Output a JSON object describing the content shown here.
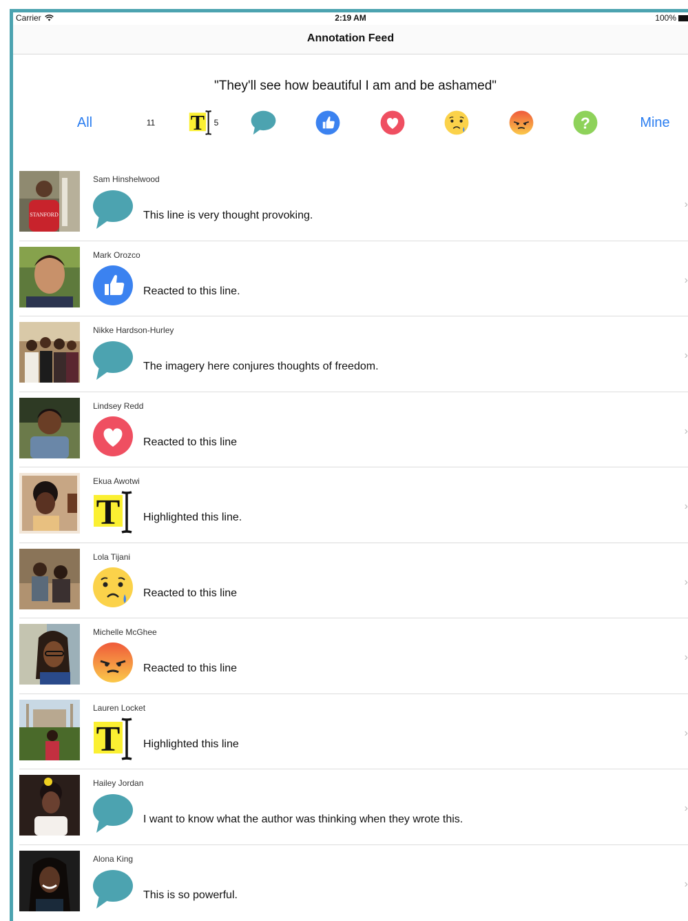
{
  "status_bar": {
    "carrier": "Carrier",
    "time": "2:19 AM",
    "battery": "100%"
  },
  "nav": {
    "title": "Annotation Feed"
  },
  "quote": "\"They'll see how beautiful I am and be ashamed\"",
  "filters": {
    "all_label": "All",
    "all_count": "11",
    "highlight_count": "5",
    "mine_label": "Mine",
    "icons": [
      "comment-icon",
      "like-icon",
      "heart-icon",
      "sad-icon",
      "angry-icon",
      "question-icon"
    ]
  },
  "colors": {
    "accent_blue": "#2a7df0",
    "comment_teal": "#4ca3b0",
    "like_blue": "#3b82f0",
    "heart_red": "#ef4f61",
    "emoji_yellow": "#fbd24a",
    "angry_orange": "#f1703a",
    "question_green": "#8ed25a",
    "highlight_yellow": "#fbf032"
  },
  "feed": [
    {
      "name": "Sam Hinshelwood",
      "type": "comment",
      "text": "This line is very thought provoking."
    },
    {
      "name": "Mark Orozco",
      "type": "like",
      "text": "Reacted to this line."
    },
    {
      "name": "Nikke Hardson-Hurley",
      "type": "comment",
      "text": "The imagery here conjures thoughts of freedom."
    },
    {
      "name": "Lindsey Redd",
      "type": "heart",
      "text": "Reacted to this line"
    },
    {
      "name": "Ekua Awotwi",
      "type": "highlight",
      "text": "Highlighted this line."
    },
    {
      "name": "Lola Tijani",
      "type": "sad",
      "text": "Reacted to this line"
    },
    {
      "name": "Michelle McGhee",
      "type": "angry",
      "text": "Reacted to this line"
    },
    {
      "name": "Lauren Locket",
      "type": "highlight",
      "text": "Highlighted this line"
    },
    {
      "name": "Hailey Jordan",
      "type": "comment",
      "text": "I want to know what the author was thinking when they wrote this."
    },
    {
      "name": "Alona King",
      "type": "comment",
      "text": "This is so powerful."
    }
  ]
}
